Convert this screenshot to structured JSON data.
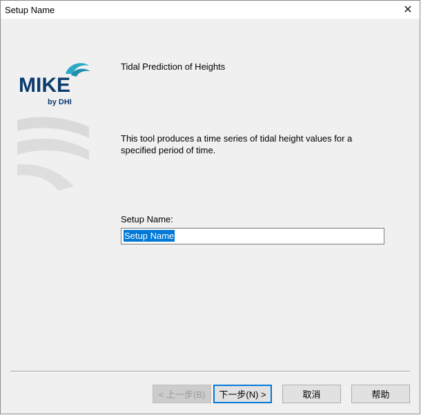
{
  "window": {
    "title": "Setup Name",
    "close_glyph": "✕"
  },
  "logo": {
    "brand": "MIKE",
    "sub": "by DHI"
  },
  "main": {
    "heading": "Tidal Prediction of Heights",
    "description": "This tool produces a time series of tidal height values for a specified period of time.",
    "field_label": "Setup Name:",
    "field_value": "Setup Name"
  },
  "buttons": {
    "back": "< 上一步(B)",
    "next": "下一步(N) >",
    "cancel": "取消",
    "help": "帮助"
  },
  "colors": {
    "accent": "#0078d7",
    "logo_text": "#0b3c6e",
    "wave": "#2aa8c4"
  }
}
